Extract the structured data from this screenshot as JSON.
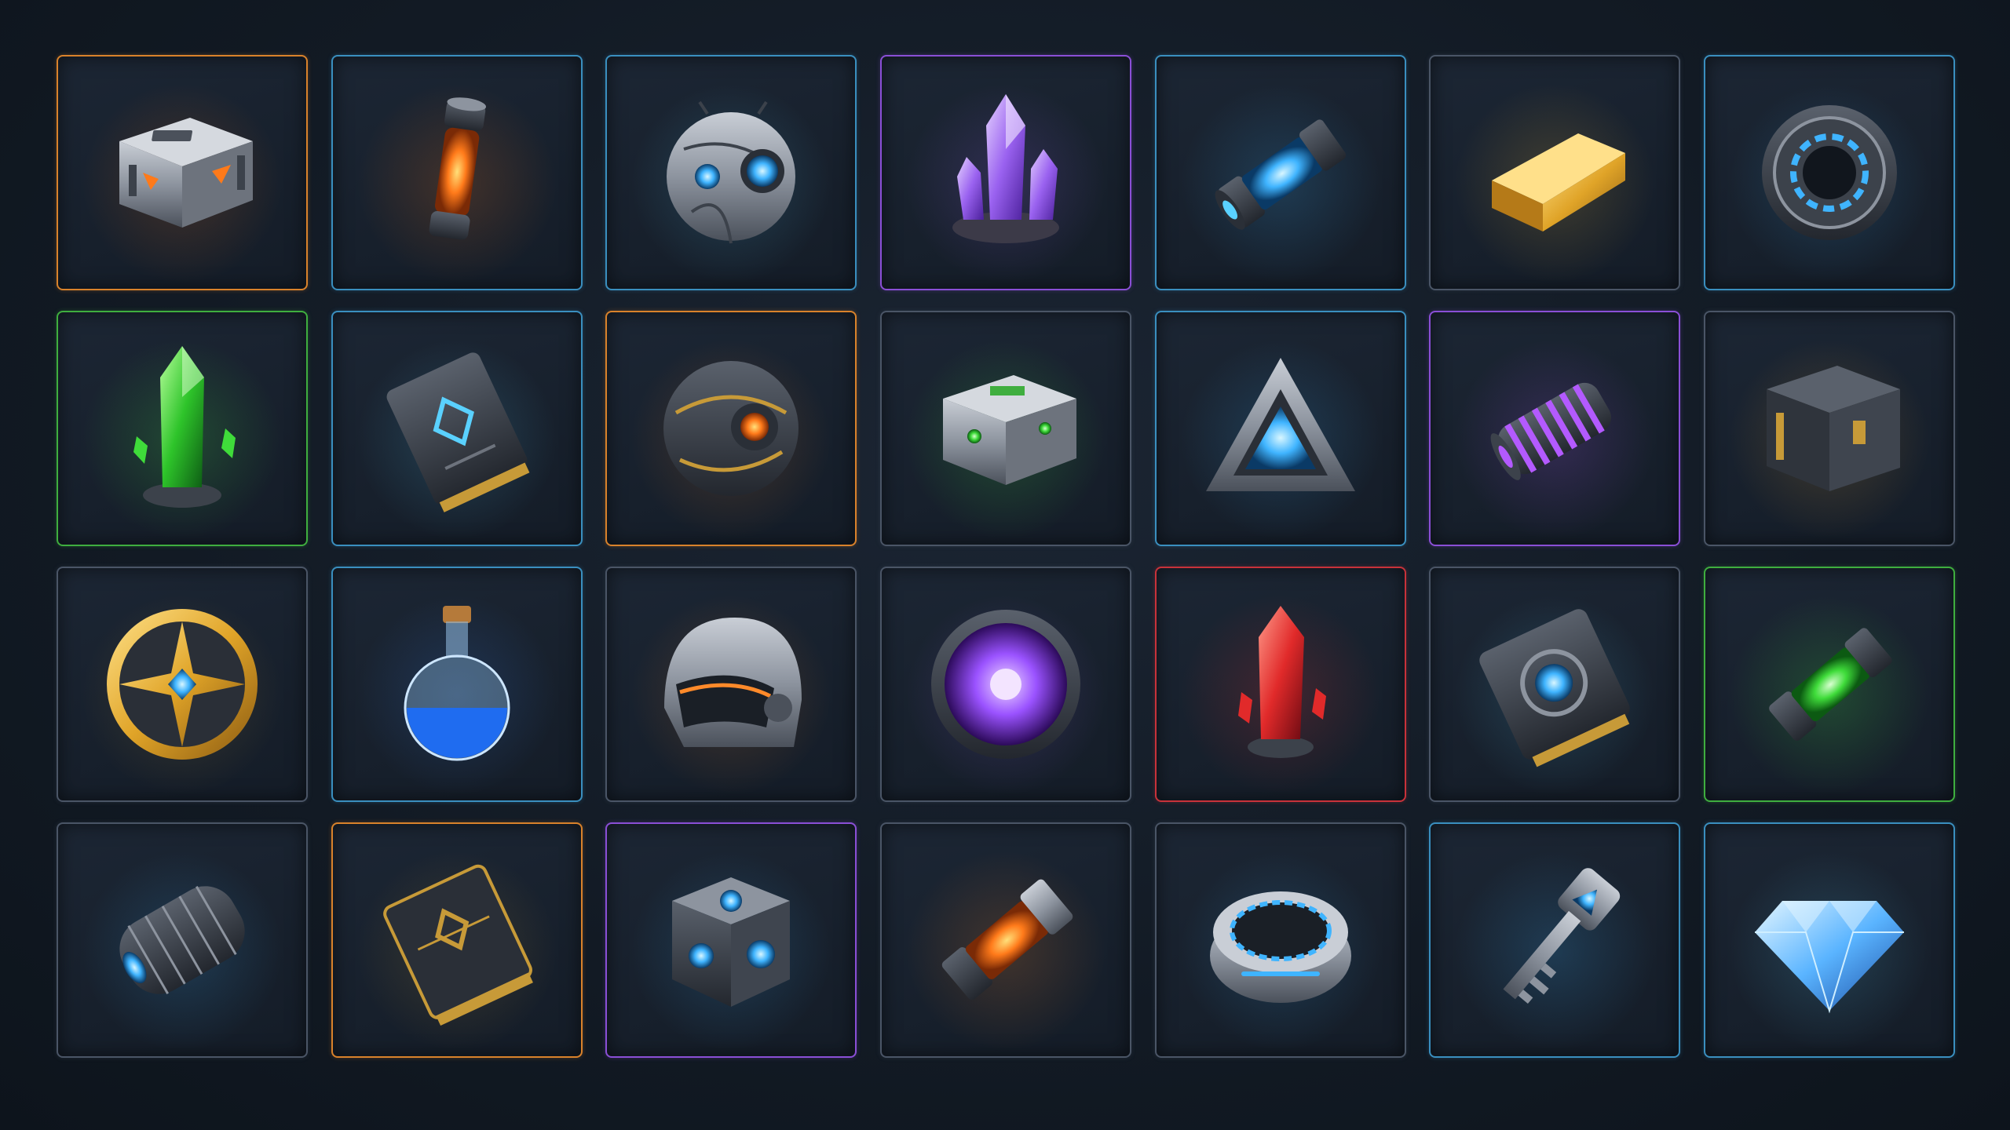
{
  "colors": {
    "orange": "#d9822b",
    "blue": "#3a8fbf",
    "purple": "#8a4fd6",
    "green": "#3fae3f",
    "red": "#c8323a",
    "gray": "#4a5566",
    "gold": "#c79a38"
  },
  "inventory": {
    "rows": [
      [
        {
          "icon": "supply-crate-icon",
          "border": "orange",
          "glow": "#ff7a1a"
        },
        {
          "icon": "orange-energy-cell-icon",
          "border": "blue",
          "glow": "#ff7a1a"
        },
        {
          "icon": "robot-orb-icon",
          "border": "blue",
          "glow": "#5ad1ff"
        },
        {
          "icon": "purple-crystal-icon",
          "border": "purple",
          "glow": "#a26bff"
        },
        {
          "icon": "blue-energy-canister-icon",
          "border": "blue",
          "glow": "#3fb4ff"
        },
        {
          "icon": "gold-bar-icon",
          "border": "gray",
          "glow": "#ffc23a"
        },
        {
          "icon": "portal-ring-icon",
          "border": "blue",
          "glow": "#3fb4ff"
        }
      ],
      [
        {
          "icon": "green-crystal-icon",
          "border": "green",
          "glow": "#4cff4c"
        },
        {
          "icon": "data-chip-icon",
          "border": "blue",
          "glow": "#5ad1ff"
        },
        {
          "icon": "core-orb-icon",
          "border": "orange",
          "glow": "#ff8a2a"
        },
        {
          "icon": "tech-chest-icon",
          "border": "gray",
          "glow": "#4cff4c"
        },
        {
          "icon": "triangle-beacon-icon",
          "border": "blue",
          "glow": "#3fb4ff"
        },
        {
          "icon": "purple-coil-icon",
          "border": "purple",
          "glow": "#b35aff"
        },
        {
          "icon": "dark-cube-crate-icon",
          "border": "gray",
          "glow": "#ffb23a"
        }
      ],
      [
        {
          "icon": "compass-medallion-icon",
          "border": "gray",
          "glow": "#c79a38"
        },
        {
          "icon": "blue-potion-icon",
          "border": "blue",
          "glow": "#3f8cff"
        },
        {
          "icon": "helmet-icon",
          "border": "gray",
          "glow": "#ff8a2a"
        },
        {
          "icon": "void-orb-icon",
          "border": "gray",
          "glow": "#a26bff"
        },
        {
          "icon": "red-crystal-icon",
          "border": "red",
          "glow": "#ff3a3a"
        },
        {
          "icon": "circuit-chip-icon",
          "border": "gray",
          "glow": "#5ad1ff"
        },
        {
          "icon": "green-energy-cell-icon",
          "border": "green",
          "glow": "#4cff4c"
        }
      ],
      [
        {
          "icon": "scrap-capsule-icon",
          "border": "gray",
          "glow": "#3fb4ff"
        },
        {
          "icon": "gold-keycard-icon",
          "border": "orange",
          "glow": "#c79a38"
        },
        {
          "icon": "power-cube-icon",
          "border": "purple",
          "glow": "#3fb4ff"
        },
        {
          "icon": "orange-fuel-cell-icon",
          "border": "gray",
          "glow": "#ff8a2a"
        },
        {
          "icon": "blue-disc-icon",
          "border": "gray",
          "glow": "#3fb4ff"
        },
        {
          "icon": "access-key-icon",
          "border": "blue",
          "glow": "#3fb4ff"
        },
        {
          "icon": "blue-diamond-icon",
          "border": "blue",
          "glow": "#5ad1ff"
        }
      ]
    ]
  }
}
